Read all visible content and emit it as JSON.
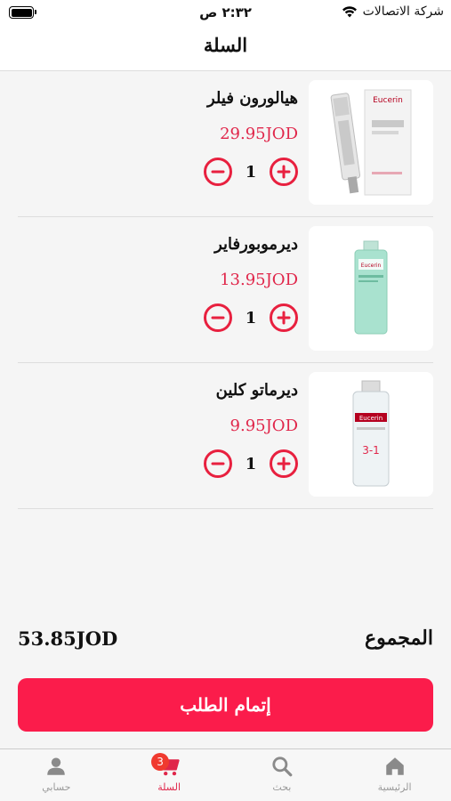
{
  "status_bar": {
    "carrier": "شركة الاتصالات",
    "time": "٢:٣٢ ص"
  },
  "header": {
    "title": "السلة"
  },
  "cart_items": [
    {
      "name": "هيالورون فيلر",
      "price": "29.95JOD",
      "quantity": "1",
      "image": "eucerin-hyaluron-filler-tube"
    },
    {
      "name": "ديرموبورفاير",
      "price": "13.95JOD",
      "quantity": "1",
      "image": "eucerin-dermopurifyer-bottle"
    },
    {
      "name": "ديرماتو كلين",
      "price": "9.95JOD",
      "quantity": "1",
      "image": "eucerin-dermatoclean-bottle"
    }
  ],
  "summary": {
    "total_label": "المجموع",
    "total_value": "53.85JOD"
  },
  "checkout_button": {
    "label": "إتمام الطلب"
  },
  "tab_bar": {
    "tabs": [
      {
        "label": "الرئيسية",
        "icon": "home-icon"
      },
      {
        "label": "بحث",
        "icon": "search-icon"
      },
      {
        "label": "السلة",
        "icon": "cart-icon",
        "badge": "3",
        "active": true
      },
      {
        "label": "حسابي",
        "icon": "person-icon"
      }
    ]
  },
  "colors": {
    "accent": "#fb1c4b",
    "price": "#e0264a",
    "badge": "#f03a2f"
  },
  "product_image_text": {
    "brand": "Eucerin",
    "badge_3in1": "3-1"
  }
}
